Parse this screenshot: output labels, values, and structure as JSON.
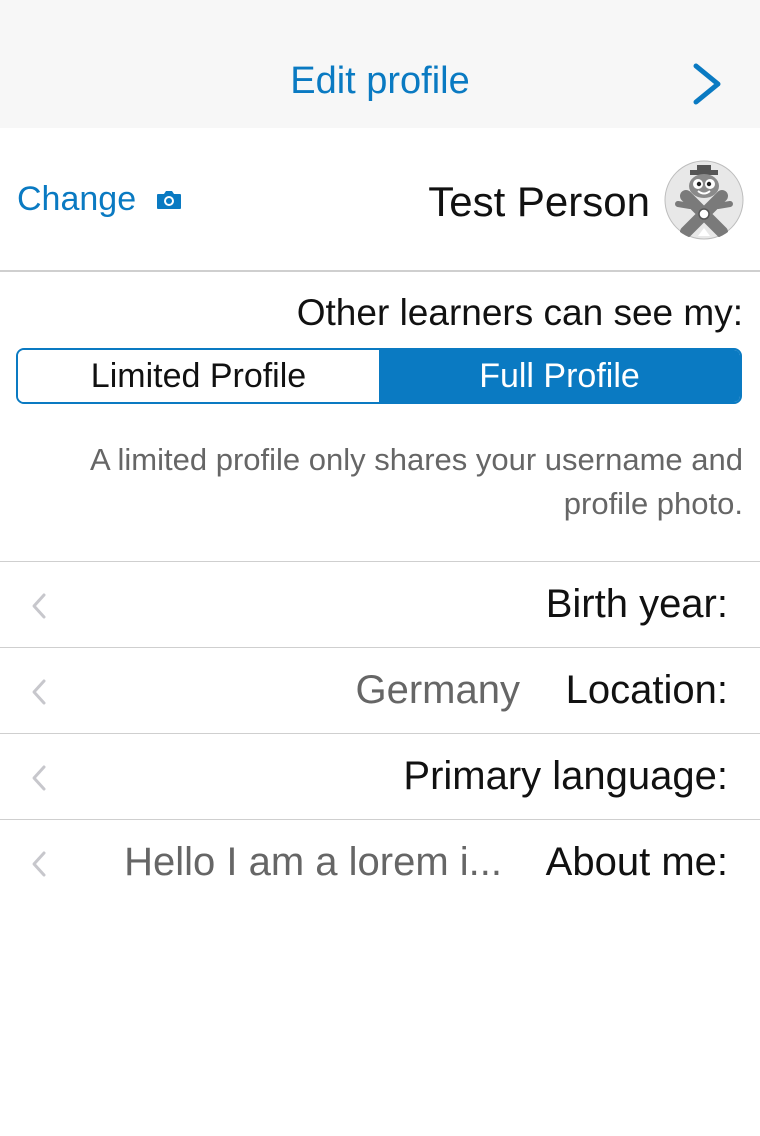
{
  "navbar": {
    "title": "Edit profile",
    "forward_icon": "chevron-right-icon",
    "accent": "#0a7ac2"
  },
  "header": {
    "change_label": "Change",
    "camera_icon": "camera-icon",
    "name": "Test Person",
    "avatar_icon": "mascot-avatar"
  },
  "visibility": {
    "label": "Other learners can see my:",
    "options": [
      "Limited Profile",
      "Full Profile"
    ],
    "selected": "Full Profile",
    "description": "A limited profile only shares your username and profile photo."
  },
  "fields": [
    {
      "label": "Birth year:",
      "value": ""
    },
    {
      "label": "Location:",
      "value": "Germany"
    },
    {
      "label": "Primary language:",
      "value": ""
    },
    {
      "label": "About me:",
      "value": "Hello I am a lorem i..."
    }
  ]
}
